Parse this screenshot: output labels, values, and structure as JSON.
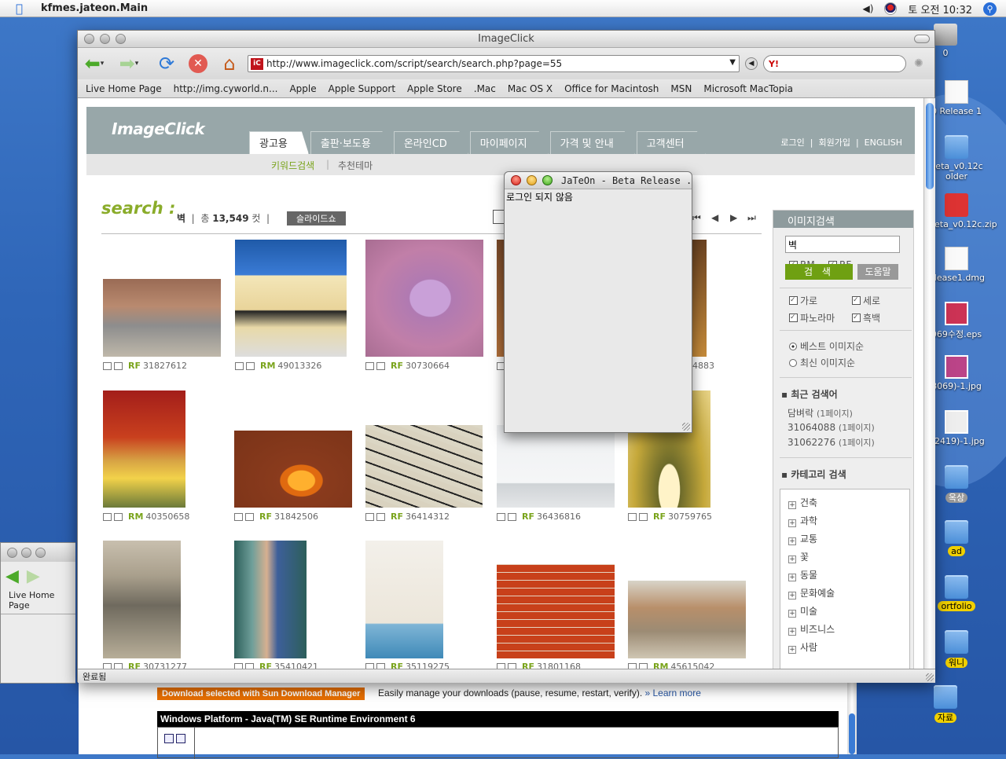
{
  "menubar": {
    "app_name": "kfmes.jateon.Main",
    "clock": "토 오전 10:32"
  },
  "desktop_icons": [
    {
      "label": "0",
      "kind": "disk"
    },
    {
      "label": "0 Release 1",
      "kind": "doc"
    },
    {
      "label": "beta_v0.12c older",
      "kind": "folder"
    },
    {
      "label": "beta_v0.12c.zip",
      "kind": "zip"
    },
    {
      "label": "elease1.dmg",
      "kind": "doc"
    },
    {
      "label": "069수정.eps",
      "kind": "image"
    },
    {
      "label": "8069)-1.jpg",
      "kind": "image"
    },
    {
      "label": "32419)-1.jpg",
      "kind": "image"
    },
    {
      "label": "옥상",
      "kind": "folder"
    },
    {
      "label": "ad",
      "kind": "folder"
    },
    {
      "label": "ortfolio",
      "kind": "folder"
    },
    {
      "label": "워니",
      "kind": "folder"
    },
    {
      "label": "자료",
      "kind": "folder"
    }
  ],
  "background_page": {
    "download_button": "Download selected with Sun Download Manager",
    "download_text": "Easily manage your downloads (pause, resume, restart, verify).",
    "learn_more": "» Learn more",
    "platform_header": "Windows Platform - Java(TM) SE Runtime Environment 6"
  },
  "window2": {
    "bookmark": "Live Home Page"
  },
  "browser": {
    "title": "ImageClick",
    "url": "http://www.imageclick.com/script/search/search.php?page=55",
    "search_engine": "Y!",
    "bookmarks": [
      "Live Home Page",
      "http://img.cyworld.n...",
      "Apple",
      "Apple Support",
      "Apple Store",
      ".Mac",
      "Mac OS X",
      "Office for Macintosh",
      "MSN",
      "Microsoft MacTopia"
    ],
    "status": "완료됨"
  },
  "page": {
    "logo": "ImageClick",
    "nav_tabs": [
      "광고용",
      "출판·보도용",
      "온라인CD",
      "마이페이지",
      "가격 및 안내",
      "고객센터"
    ],
    "top_links": [
      "로그인",
      "회원가입",
      "ENGLISH"
    ],
    "subnav": [
      "키워드검색",
      "추천테마"
    ],
    "search_label": "search :",
    "query": "벽",
    "total_prefix": "총",
    "total_count": "13,549",
    "total_suffix": "컷",
    "slideshow": "슬라이드쇼",
    "thumbnails": [
      {
        "lic": "RF",
        "id": "31827612"
      },
      {
        "lic": "RM",
        "id": "49013326"
      },
      {
        "lic": "RF",
        "id": "30730664"
      },
      {
        "lic": "",
        "id": ""
      },
      {
        "lic": "",
        "id": "4883"
      },
      {
        "lic": "RM",
        "id": "40350658"
      },
      {
        "lic": "RF",
        "id": "31842506"
      },
      {
        "lic": "RF",
        "id": "36414312"
      },
      {
        "lic": "RF",
        "id": "36436816"
      },
      {
        "lic": "RF",
        "id": "30759765"
      },
      {
        "lic": "RF",
        "id": "30731277"
      },
      {
        "lic": "RF",
        "id": "35410421"
      },
      {
        "lic": "RF",
        "id": "35119275"
      },
      {
        "lic": "RF",
        "id": "31801168"
      },
      {
        "lic": "RM",
        "id": "45615042"
      }
    ],
    "panel": {
      "title": "이미지검색",
      "input_value": "벽",
      "rm": "RM",
      "rf": "RF",
      "search_btn": "검 색",
      "help_btn": "도움말",
      "orient": [
        "가로",
        "세로",
        "파노라마",
        "흑백"
      ],
      "sort": [
        "베스트 이미지순",
        "최신 이미지순"
      ],
      "recent_title": "최근 검색어",
      "recent": [
        {
          "term": "담벼락",
          "page": "(1페이지)"
        },
        {
          "term": "31064088",
          "page": "(1페이지)"
        },
        {
          "term": "31062276",
          "page": "(1페이지)"
        }
      ],
      "category_title": "카테고리 검색",
      "categories": [
        "건축",
        "과학",
        "교통",
        "꽃",
        "동물",
        "문화예술",
        "미술",
        "비즈니스",
        "사람"
      ]
    }
  },
  "jateon": {
    "title": "JaTeOn - Beta Release ...",
    "status": "로그인 되지 않음"
  }
}
